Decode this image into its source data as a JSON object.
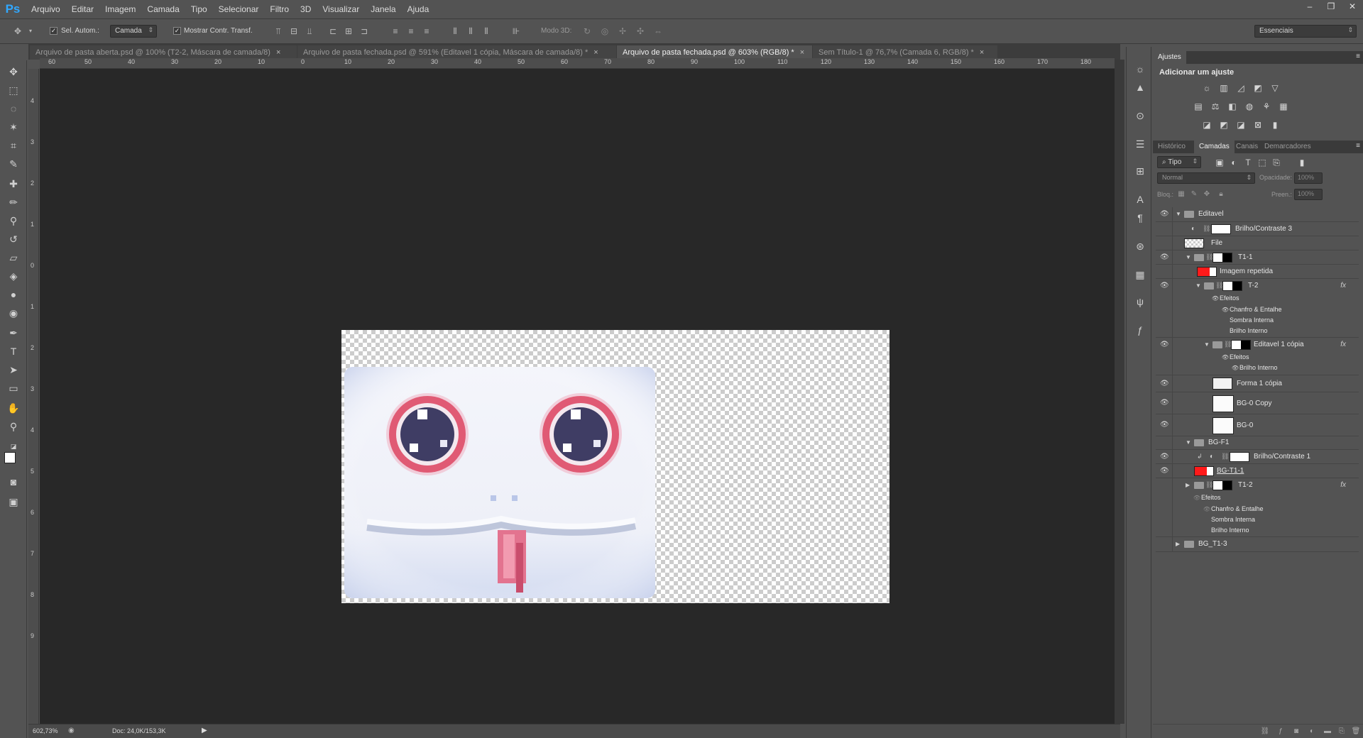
{
  "app": {
    "logo": "Ps"
  },
  "menu": [
    "Arquivo",
    "Editar",
    "Imagem",
    "Camada",
    "Tipo",
    "Selecionar",
    "Filtro",
    "3D",
    "Visualizar",
    "Janela",
    "Ajuda"
  ],
  "window_controls": {
    "minimize": "–",
    "restore": "❐",
    "close": "✕"
  },
  "options": {
    "auto_select_label": "Sel. Autom.:",
    "auto_select_target": "Camada",
    "show_transform_label": "Mostrar Contr. Transf.",
    "mode_3d_label": "Modo 3D:",
    "workspace": "Essenciais"
  },
  "tabs": [
    {
      "label": "Arquivo de pasta aberta.psd @ 100% (T2-2, Máscara de camada/8)",
      "active": false
    },
    {
      "label": "Arquivo de pasta fechada.psd @ 591% (Editavel 1 cópia, Máscara de camada/8) *",
      "active": false
    },
    {
      "label": "Arquivo de pasta fechada.psd @ 603% (RGB/8) *",
      "active": true
    },
    {
      "label": "Sem Título-1 @ 76,7% (Camada 6, RGB/8) *",
      "active": false
    }
  ],
  "ruler_h": [
    "60",
    "50",
    "40",
    "30",
    "20",
    "10",
    "0",
    "10",
    "20",
    "30",
    "40",
    "50",
    "60",
    "70",
    "80",
    "90",
    "100",
    "110",
    "120",
    "130",
    "140",
    "150",
    "160",
    "170",
    "180"
  ],
  "ruler_v": [
    "4",
    "3",
    "2",
    "1",
    "0",
    "1",
    "2",
    "3",
    "4",
    "5",
    "6",
    "7",
    "8",
    "9"
  ],
  "status": {
    "zoom": "602,73%",
    "doc": "Doc: 24,0K/153,3K"
  },
  "adjustments": {
    "tab": "Ajustes",
    "heading": "Adicionar um ajuste"
  },
  "layer_tabs": [
    "Histórico",
    "Camadas",
    "Canais",
    "Demarcadores"
  ],
  "layers_panel": {
    "filter_kind": "Tipo",
    "blend_mode": "Normal",
    "opacity_label": "Opacidade:",
    "opacity_value": "100%",
    "lock_label": "Bloq.:",
    "fill_label": "Preen.:",
    "fill_value": "100%"
  },
  "layers": [
    {
      "name": "Editavel"
    },
    {
      "name": "Brilho/Contraste 3"
    },
    {
      "name": "File"
    },
    {
      "name": "T1-1"
    },
    {
      "name": "Imagem repetida"
    },
    {
      "name": "T-2",
      "fx": "fx"
    },
    {
      "name": "Efeitos"
    },
    {
      "name": "Chanfro & Entalhe"
    },
    {
      "name": "Sombra Interna"
    },
    {
      "name": "Brilho Interno"
    },
    {
      "name": "Editavel 1 cópia",
      "fx": "fx"
    },
    {
      "name": "Efeitos"
    },
    {
      "name": "Brilho Interno"
    },
    {
      "name": "Forma 1 cópia"
    },
    {
      "name": "BG-0 Copy"
    },
    {
      "name": "BG-0"
    },
    {
      "name": "BG-F1"
    },
    {
      "name": "Brilho/Contraste 1"
    },
    {
      "name": "BG-T1-1"
    },
    {
      "name": "T1-2",
      "fx": "fx"
    },
    {
      "name": "Efeitos"
    },
    {
      "name": "Chanfro & Entalhe"
    },
    {
      "name": "Sombra Interna"
    },
    {
      "name": "Brilho Interno"
    },
    {
      "name": "BG_T1-3"
    }
  ],
  "colors": {
    "ui": "#535353",
    "canvas": "#282828",
    "accent": "#31a8ff",
    "red_thumb": "#ff1a1a"
  }
}
